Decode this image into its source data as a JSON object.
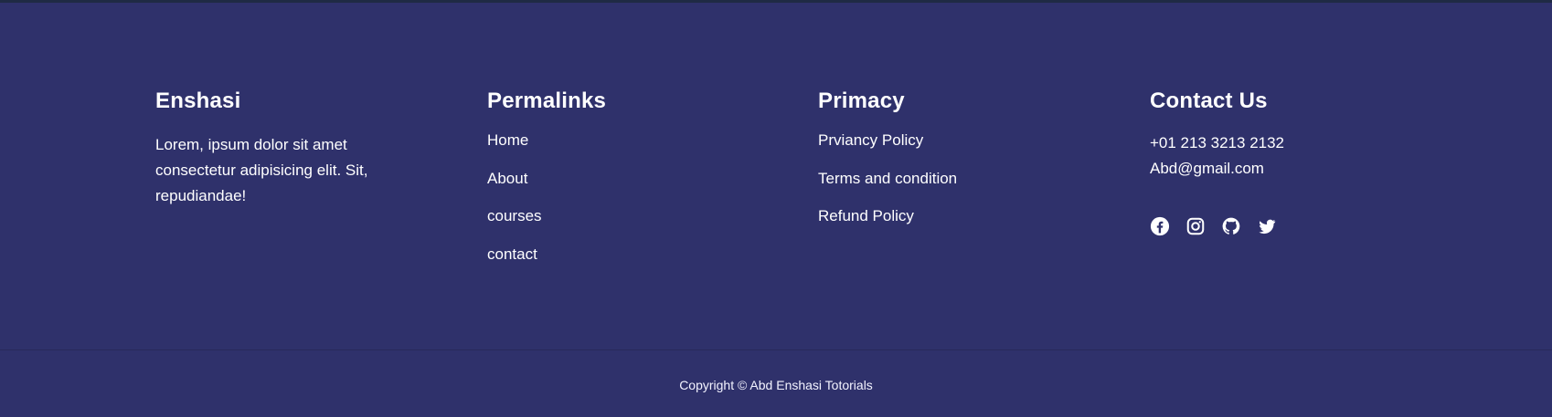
{
  "footer": {
    "brand": {
      "title": "Enshasi",
      "description": "Lorem, ipsum dolor sit amet consectetur adipisicing elit. Sit, repudiandae!"
    },
    "permalinks": {
      "title": "Permalinks",
      "items": [
        "Home",
        "About",
        "courses",
        "contact"
      ]
    },
    "privacy": {
      "title": "Primacy",
      "items": [
        "Prviancy Policy",
        "Terms and condition",
        "Refund Policy"
      ]
    },
    "contact": {
      "title": "Contact Us",
      "phone": "+01 213 3213 2132",
      "email": "Abd@gmail.com",
      "socials": [
        "facebook-icon",
        "instagram-icon",
        "github-icon",
        "twitter-icon"
      ]
    },
    "copyright": "Copyright © Abd Enshasi Totorials"
  },
  "colors": {
    "background": "#2f316b",
    "text": "#ffffff",
    "top_rule": "#1f2a44"
  }
}
